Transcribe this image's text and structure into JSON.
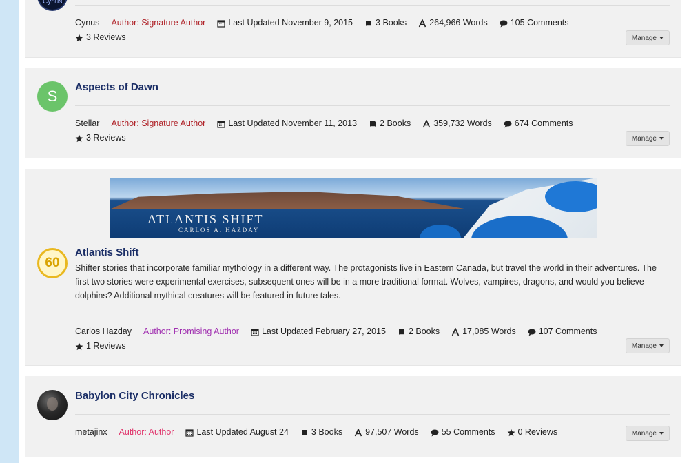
{
  "colors": {
    "signature_author": "#b0242a",
    "promising_author": "#a02fb0",
    "author": "#e0356c",
    "title": "#1b2e66"
  },
  "manage_label": "Manage",
  "stories": [
    {
      "title": "",
      "avatar": "Cynus",
      "author": "Cynus",
      "rank": "Author: Signature Author",
      "updated": "Last Updated November 9, 2015",
      "books": "3 Books",
      "words": "264,966 Words",
      "comments": "105 Comments",
      "reviews": "3 Reviews"
    },
    {
      "title": "Aspects of Dawn",
      "avatar": "S",
      "author": "Stellar",
      "rank": "Author: Signature Author",
      "updated": "Last Updated November 11, 2013",
      "books": "2 Books",
      "words": "359,732 Words",
      "comments": "674 Comments",
      "reviews": "3 Reviews"
    },
    {
      "title": "Atlantis Shift",
      "badge": "60",
      "banner_title": "ATLANTIS SHIFT",
      "banner_subtitle": "CARLOS A. HAZDAY",
      "description": "Shifter stories that incorporate familiar mythology in a different way. The protagonists live in Eastern Canada, but travel the world in their adventures. The first two stories were experimental exercises, subsequent ones will be in a more traditional format. Wolves, vampires, dragons, and would you believe dolphins? Additional mythical creatures will be featured in future tales.",
      "author": "Carlos Hazday",
      "rank": "Author: Promising Author",
      "updated": "Last Updated February 27, 2015",
      "books": "2 Books",
      "words": "17,085 Words",
      "comments": "107 Comments",
      "reviews": "1 Reviews"
    },
    {
      "title": "Babylon City Chronicles",
      "author": "metajinx",
      "rank": "Author: Author",
      "updated": "Last Updated August 24",
      "books": "3 Books",
      "words": "97,507 Words",
      "comments": "55 Comments",
      "reviews": "0 Reviews"
    }
  ]
}
